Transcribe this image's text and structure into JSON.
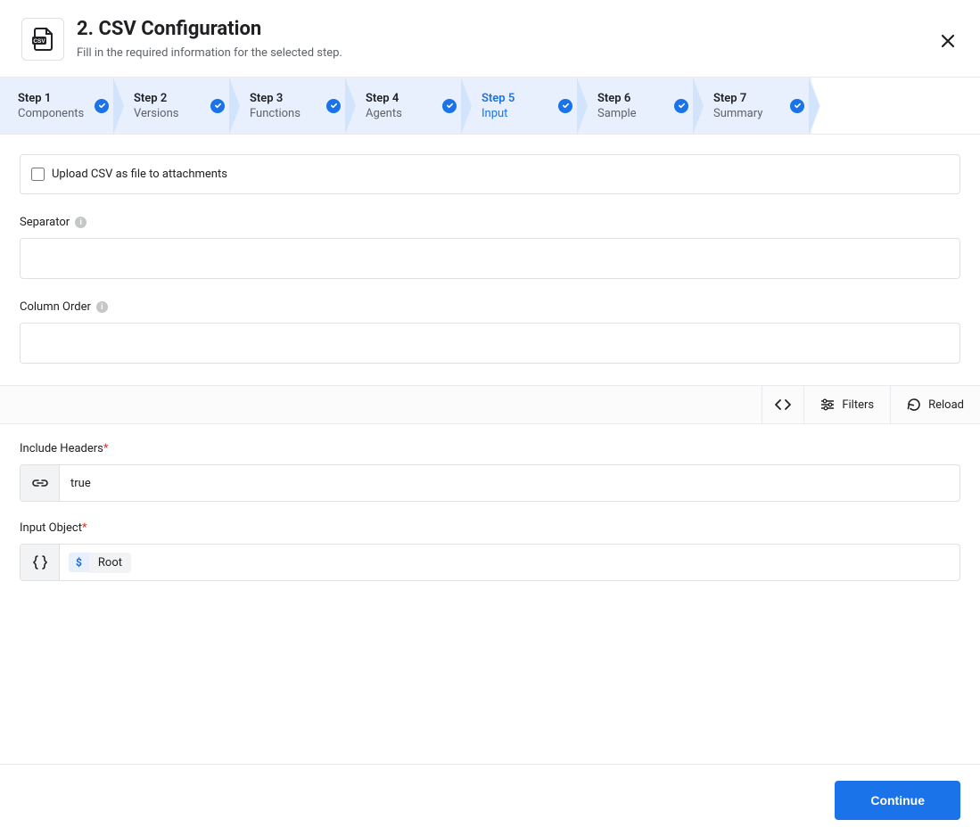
{
  "header": {
    "title": "2. CSV Configuration",
    "subtitle": "Fill in the required information for the selected step.",
    "icon": "csv-file-icon"
  },
  "stepper": {
    "steps": [
      {
        "label": "Step 1",
        "sublabel": "Components",
        "complete": true,
        "current": false
      },
      {
        "label": "Step 2",
        "sublabel": "Versions",
        "complete": true,
        "current": false
      },
      {
        "label": "Step 3",
        "sublabel": "Functions",
        "complete": true,
        "current": false
      },
      {
        "label": "Step 4",
        "sublabel": "Agents",
        "complete": true,
        "current": false
      },
      {
        "label": "Step 5",
        "sublabel": "Input",
        "complete": true,
        "current": true
      },
      {
        "label": "Step 6",
        "sublabel": "Sample",
        "complete": true,
        "current": false
      },
      {
        "label": "Step 7",
        "sublabel": "Summary",
        "complete": true,
        "current": false
      }
    ]
  },
  "form": {
    "upload_checkbox_label": "Upload CSV as file to attachments",
    "upload_checkbox_checked": false,
    "separator_label": "Separator",
    "separator_value": "",
    "column_order_label": "Column Order",
    "column_order_value": "",
    "include_headers_label": "Include Headers",
    "include_headers_value": "true",
    "input_object_label": "Input Object",
    "input_object_chip_symbol": "$",
    "input_object_chip_text": "Root"
  },
  "toolbar": {
    "filters_label": "Filters",
    "reload_label": "Reload"
  },
  "footer": {
    "continue_label": "Continue"
  }
}
